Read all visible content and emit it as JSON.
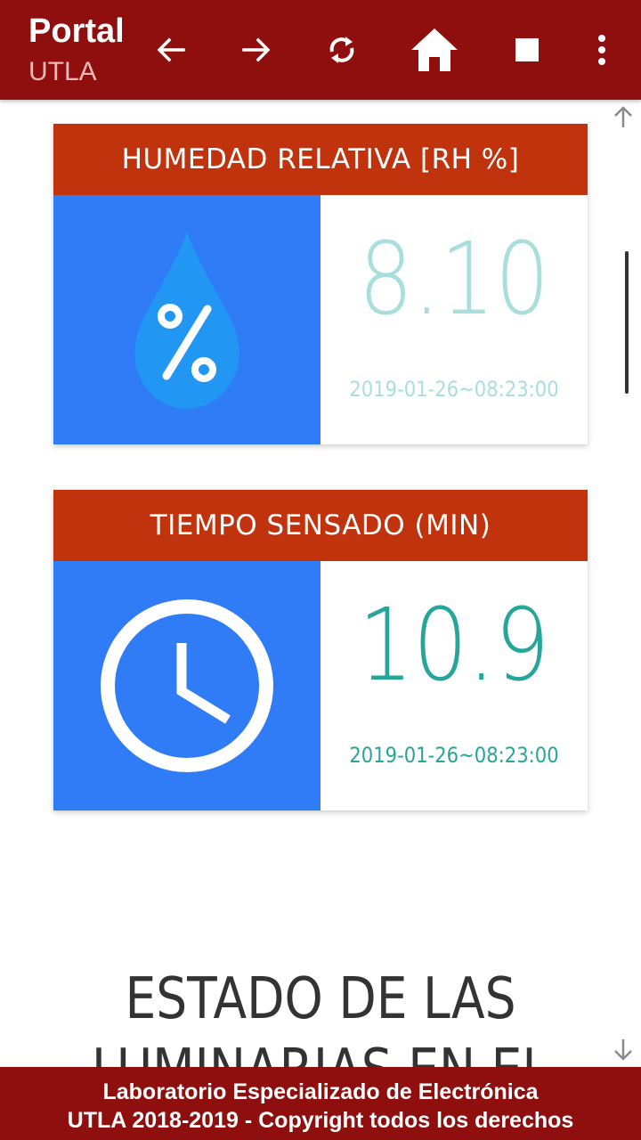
{
  "appbar": {
    "title": "Portal",
    "subtitle": "UTLA",
    "icons": [
      "arrow-back-icon",
      "arrow-forward-icon",
      "refresh-icon",
      "home-icon",
      "stop-icon",
      "more-vert-icon"
    ]
  },
  "cards": [
    {
      "header": "HUMEDAD RELATIVA [RH %]",
      "icon": "humidity-drop-icon",
      "value": "8.10",
      "timestamp": "2019-01-26~08:23:00",
      "value_color": "#a8dfdc"
    },
    {
      "header": "TIEMPO SENSADO (MIN)",
      "icon": "clock-icon",
      "value": "10.9",
      "timestamp": "2019-01-26~08:23:00",
      "value_color": "#26a69a"
    }
  ],
  "section": {
    "title_line1": "ESTADO DE LAS",
    "title_line2": "LUMINARIAS EN EL"
  },
  "footer": {
    "line1": "Laboratorio Especializado de Electrónica",
    "line2": "UTLA 2018-2019 - Copyright todos los derechos"
  },
  "colors": {
    "appbar": "#8f0e0e",
    "card_header": "#c1330c",
    "icon_panel": "#2f7cf6"
  }
}
